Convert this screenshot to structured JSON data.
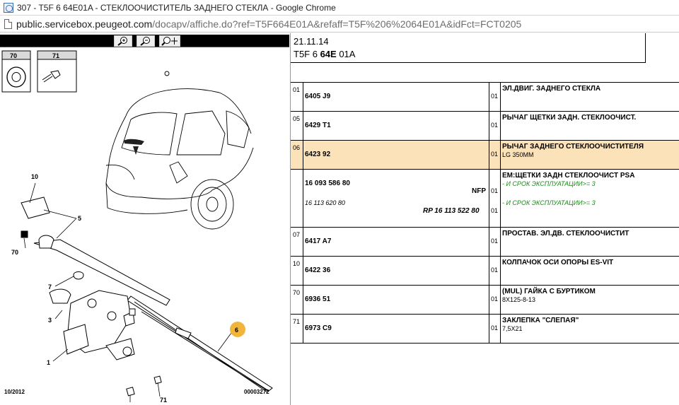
{
  "window": {
    "title": "307 - T5F 6 64E01A - СТЕКЛООЧИСТИТЕЛЬ ЗАДНЕГО СТЕКЛА - Google Chrome"
  },
  "address": {
    "host": "public.servicebox.peugeot.com",
    "path": "/docapv/affiche.do?ref=T5F664E01A&refaff=T5F%206%2064E01A&idFct=FCT0205"
  },
  "toolbar": {
    "zoom_in_icon": "zoom-in-icon",
    "zoom_out_icon": "zoom-out-icon",
    "zoom_pan_icon": "zoom-pan-icon"
  },
  "diagram": {
    "labels": [
      "70",
      "71",
      "10",
      "5",
      "70",
      "7",
      "3",
      "1",
      "6",
      "71",
      "71"
    ],
    "footer_left": "10/2012",
    "footer_right": "00003272"
  },
  "header": {
    "date": "21.11.14",
    "code_prefix": "T5F 6 ",
    "code_bold": "64E",
    "code_suffix": " 01A"
  },
  "parts": [
    {
      "pos": "01",
      "ref": "6405 J9",
      "qty": "01",
      "desc": "ЭЛ.ДВИГ. ЗАДНЕГО СТЕКЛА",
      "note": ""
    },
    {
      "pos": "05",
      "ref": "6429 T1",
      "qty": "01",
      "desc": "РЫЧАГ ЩЕТКИ ЗАДН. СТЕКЛООЧИСТ.",
      "note": ""
    },
    {
      "pos": "06",
      "ref": "6423 92",
      "qty": "01",
      "desc": "РЫЧАГ ЗАДНЕГО СТЕКЛООЧИСТИТЕЛЯ",
      "note": "LG 350MM",
      "selected": true
    },
    {
      "pos": "",
      "ref": "16 093 586 80",
      "nfp": "NFP",
      "ref2": "16 113 620 80",
      "rp": "RP 16 113 522 80",
      "qty2": "01",
      "qty3": "01",
      "desc": "ЕМ:ЩЕТКИ ЗАДН СТЕКЛООЧИСТ PSA",
      "note_green1": "- И СРОК ЭКСПЛУАТАЦИИ>= 3",
      "note_green2": "- И СРОК ЭКСПЛУАТАЦИИ>= 3"
    },
    {
      "pos": "07",
      "ref": "6417 A7",
      "qty": "01",
      "desc": "ПРОСТАВ. ЭЛ.ДВ. СТЕКЛООЧИСТИТ",
      "note": ""
    },
    {
      "pos": "10",
      "ref": "6422 36",
      "qty": "01",
      "desc": "КОЛПАЧОК ОСИ ОПОРЫ ES-VIT",
      "note": ""
    },
    {
      "pos": "70",
      "ref": "6936 51",
      "qty": "01",
      "desc": "(MUL) ГАЙКА С БУРТИКОМ",
      "note": "8X125-8-13"
    },
    {
      "pos": "71",
      "ref": "6973 C9",
      "qty": "01",
      "desc": "ЗАКЛЕПКА \"СЛЕПАЯ\"",
      "note": "7,5X21"
    }
  ]
}
